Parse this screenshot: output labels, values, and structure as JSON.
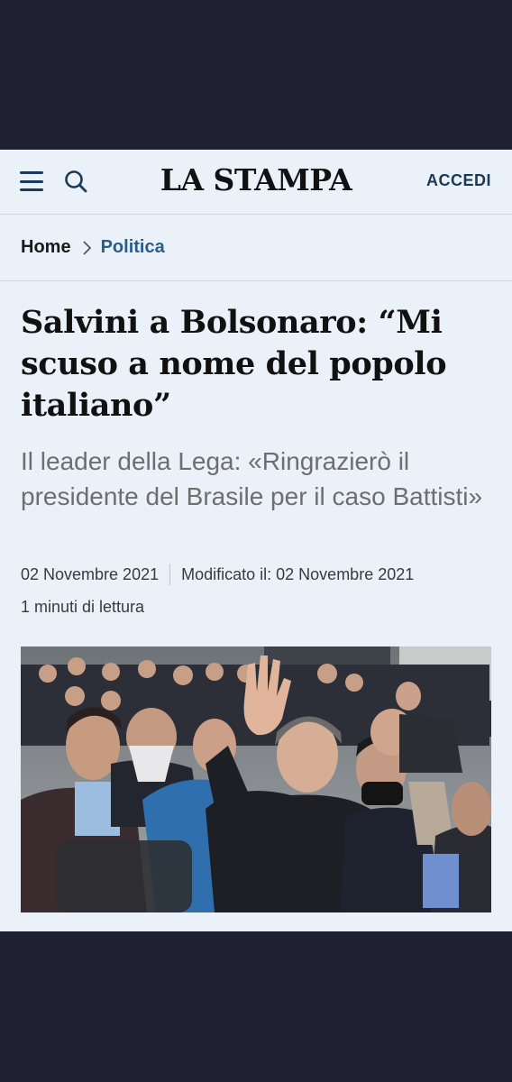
{
  "header": {
    "logo": "LA STAMPA",
    "login_label": "ACCEDI"
  },
  "breadcrumb": {
    "home": "Home",
    "section": "Politica"
  },
  "article": {
    "headline": "Salvini a Bolsonaro: “Mi scuso a nome del popolo italiano”",
    "subtitle": "Il leader della Lega: «Ringrazierò il presidente del Brasile per il caso Battisti»",
    "published": "02 Novembre 2021",
    "modified": "Modificato il: 02 Novembre 2021",
    "read_time": "1 minuti di lettura"
  },
  "icons": {
    "menu": "hamburger-menu-icon",
    "search": "search-icon",
    "breadcrumb_separator": "chevron-right-icon"
  },
  "colors": {
    "page_background": "#ebf1f8",
    "frame_background": "#1f2130",
    "accent": "#2a5d8a",
    "subtitle_text": "#6e6e6e"
  }
}
